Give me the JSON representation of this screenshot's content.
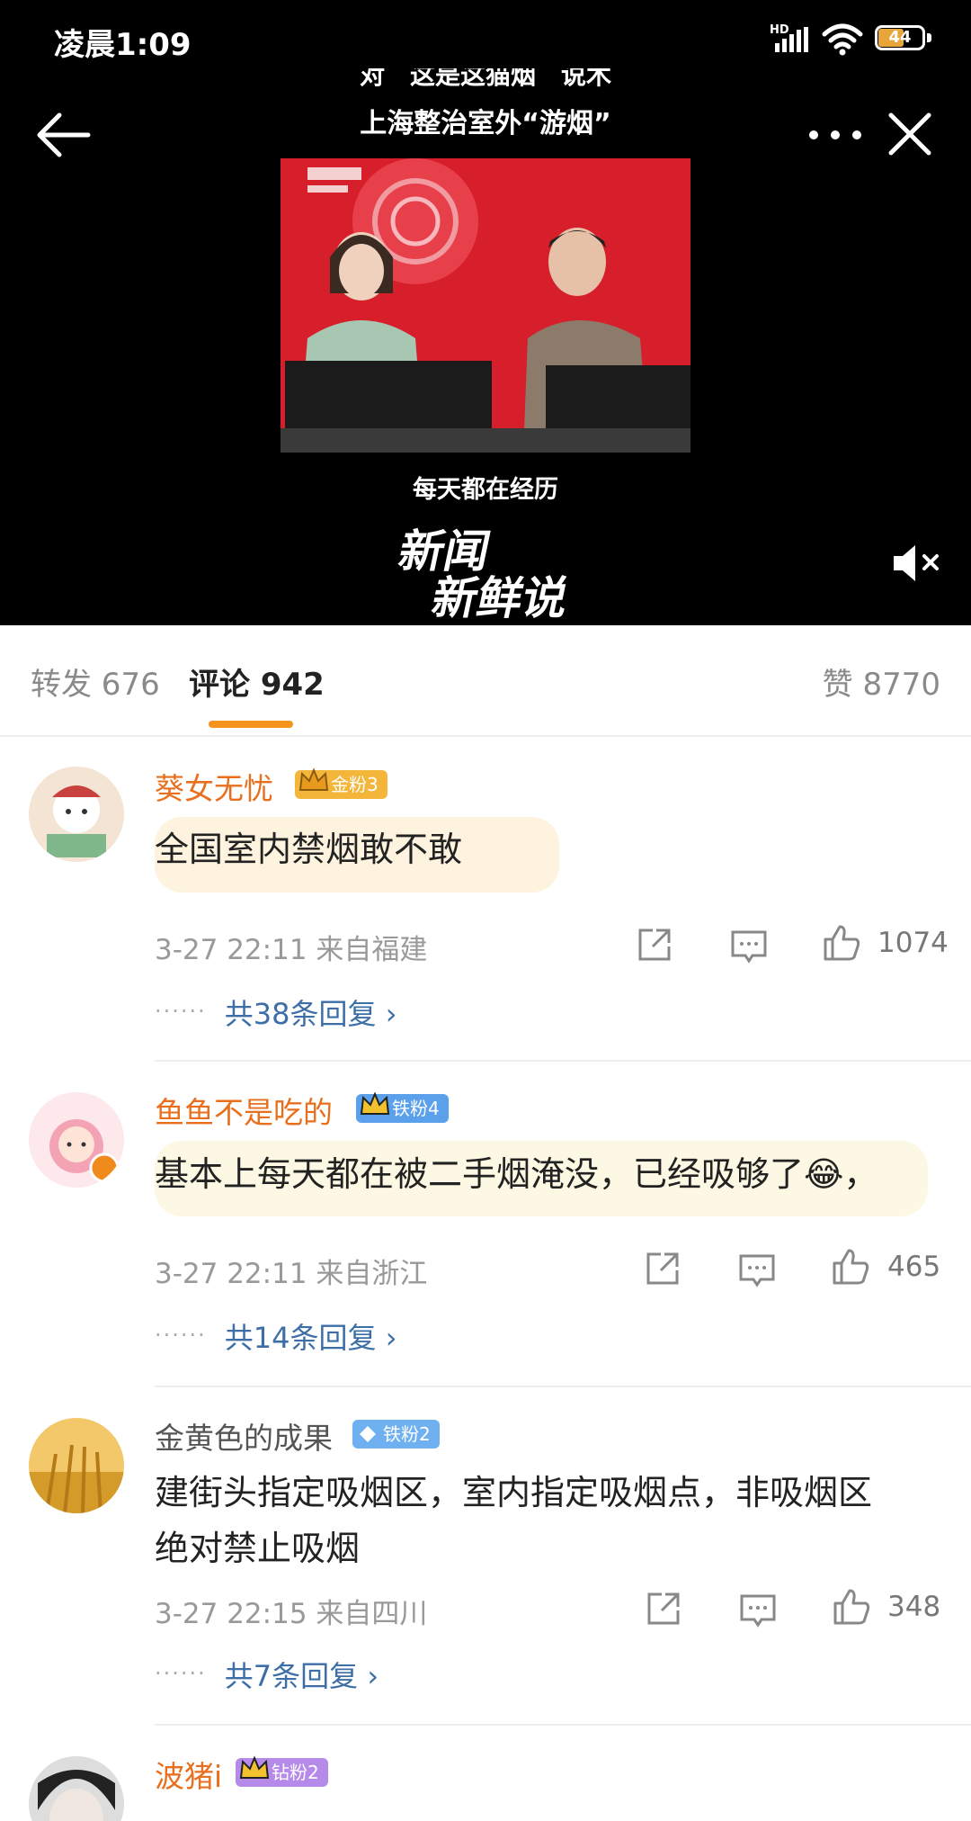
{
  "status_bar": {
    "time": "凌晨1:09",
    "network": "HD",
    "battery": "44"
  },
  "video": {
    "subtitle_partial": "对　这是这猫烟　说木",
    "title": "上海整治室外“游烟”",
    "caption": "每天都在经历",
    "show_logo": "新闻新鲜说"
  },
  "tabs": {
    "repost": "转发 676",
    "comment": "评论 942",
    "like": "赞 8770"
  },
  "comments": [
    {
      "user": "葵女无忧",
      "badge": "金粉3",
      "badge_color": "#f3b63b",
      "text": "全国室内禁烟敢不敢",
      "time": "3-27 22:11",
      "location": "来自福建",
      "likes": "1074",
      "replies": "共38条回复"
    },
    {
      "user": "鱼鱼不是吃的",
      "badge": "铁粉4",
      "badge_color": "#5aa0ea",
      "text": "基本上每天都在被二手烟淹没，已经吸够了😂，",
      "time": "3-27 22:11",
      "location": "来自浙江",
      "likes": "465",
      "replies": "共14条回复"
    },
    {
      "user": "金黄色的成果",
      "badge": "铁粉2",
      "badge_color": "#6fb1f0",
      "text_line1": "建街头指定吸烟区，室内指定吸烟点，非吸烟区",
      "text_line2": "绝对禁止吸烟",
      "time": "3-27 22:15",
      "location": "来自四川",
      "likes": "348",
      "replies": "共7条回复"
    },
    {
      "user": "波猪i",
      "badge": "钻粉2",
      "badge_color": "#b58ae8"
    }
  ],
  "icons": {
    "repost": "share-icon",
    "reply": "comment-icon",
    "like": "thumbs-up-icon"
  }
}
